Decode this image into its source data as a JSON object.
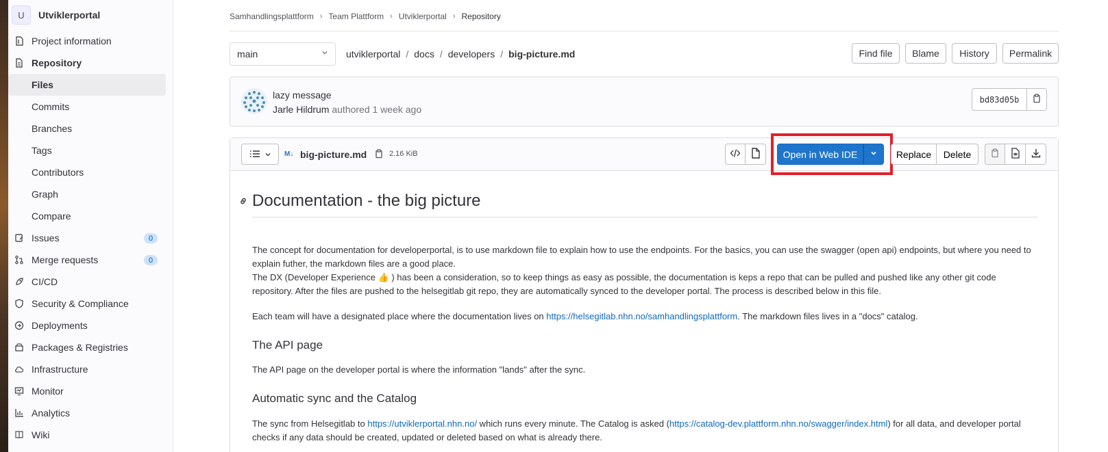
{
  "sidebar": {
    "project_initial": "U",
    "project_name": "Utviklerportal",
    "items": [
      {
        "label": "Project information"
      },
      {
        "label": "Repository"
      },
      {
        "label": "Issues",
        "badge": "0"
      },
      {
        "label": "Merge requests",
        "badge": "0"
      },
      {
        "label": "CI/CD"
      },
      {
        "label": "Security & Compliance"
      },
      {
        "label": "Deployments"
      },
      {
        "label": "Packages & Registries"
      },
      {
        "label": "Infrastructure"
      },
      {
        "label": "Monitor"
      },
      {
        "label": "Analytics"
      },
      {
        "label": "Wiki"
      }
    ],
    "repo_sub": [
      "Files",
      "Commits",
      "Branches",
      "Tags",
      "Contributors",
      "Graph",
      "Compare"
    ]
  },
  "breadcrumb": [
    "Samhandlingsplattform",
    "Team Plattform",
    "Utviklerportal",
    "Repository"
  ],
  "branch": "main",
  "path": [
    "utviklerportal",
    "docs",
    "developers",
    "big-picture.md"
  ],
  "top_buttons": {
    "find_file": "Find file",
    "blame": "Blame",
    "history": "History",
    "permalink": "Permalink"
  },
  "commit": {
    "title": "lazy message",
    "author": "Jarle Hildrum",
    "meta": " authored 1 week ago",
    "sha": "bd83d05b"
  },
  "file": {
    "md_badge": "M↓",
    "name": "big-picture.md",
    "size": "2.16 KiB",
    "open_ide": "Open in Web IDE",
    "replace": "Replace",
    "delete": "Delete"
  },
  "doc": {
    "h1": "Documentation - the big picture",
    "p1_a": "The concept for documentation for developerportal, is to use markdown file to explain how to use the endpoints. For the basics, you can use the swagger (open api) endpoints, but where you need to explain futher, the markdown files are a good place.",
    "p1_b_pre": "The DX (Developer Experience ",
    "p1_b_emoji": "👍",
    "p1_b_post": " ) has been a consideration, so to keep things as easy as possible, the documentation is keps a repo that can be pulled and pushed like any other git code repository. After the files are pushed to the helsegitlab git repo, they are automatically synced to the developer portal. The process is described below in this file.",
    "p2_pre": "Each team will have a designated place where the documentation lives on ",
    "p2_link": "https://helsegitlab.nhn.no/samhandlingsplattform",
    "p2_post": ". The markdown files lives in a \"docs\" catalog.",
    "h2_api": "The API page",
    "p3": "The API page on the developer portal is where the information \"lands\" after the sync.",
    "h2_sync": "Automatic sync and the Catalog",
    "p4_pre": "The sync from Helsegitlab to ",
    "p4_link1": "https://utviklerportal.nhn.no/",
    "p4_mid": " which runs every minute. The Catalog is asked (",
    "p4_link2": "https://catalog-dev.plattform.nhn.no/swagger/index.html",
    "p4_post": ") for all data, and developer portal checks if any data should be created, updated or deleted based on what is already there."
  },
  "colors": {
    "accent": "#1f75cb",
    "highlight": "#e0202b",
    "link": "#1068bf"
  }
}
